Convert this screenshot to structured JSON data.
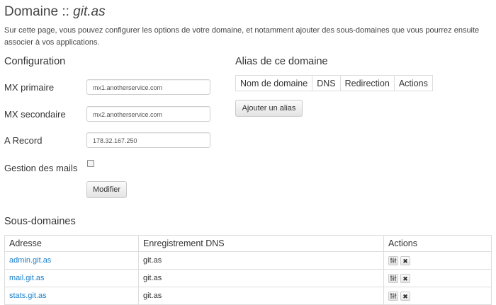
{
  "header": {
    "title_prefix": "Domaine :: ",
    "domain": "git.as",
    "description": "Sur cette page, vous pouvez configurer les options de votre domaine, et notamment ajouter des sous-domaines que vous pourrez ensuite associer à vos applications."
  },
  "configuration": {
    "heading": "Configuration",
    "mx_primary_label": "MX primaire",
    "mx_primary_value": "mx1.anotherservice.com",
    "mx_secondary_label": "MX secondaire",
    "mx_secondary_value": "mx2.anotherservice.com",
    "a_record_label": "A Record",
    "a_record_value": "178.32.167.250",
    "mail_management_label": "Gestion des mails",
    "modify_button": "Modifier"
  },
  "aliases": {
    "heading": "Alias de ce domaine",
    "columns": [
      "Nom de domaine",
      "DNS",
      "Redirection",
      "Actions"
    ],
    "add_button": "Ajouter un alias"
  },
  "subdomains": {
    "heading": "Sous-domaines",
    "columns": [
      "Adresse",
      "Enregistrement DNS",
      "Actions"
    ],
    "rows": [
      {
        "address": "admin.git.as",
        "dns": "git.as"
      },
      {
        "address": "mail.git.as",
        "dns": "git.as"
      },
      {
        "address": "stats.git.as",
        "dns": "git.as"
      }
    ],
    "edit_icon": "sliders-icon",
    "delete_icon": "close-icon"
  }
}
